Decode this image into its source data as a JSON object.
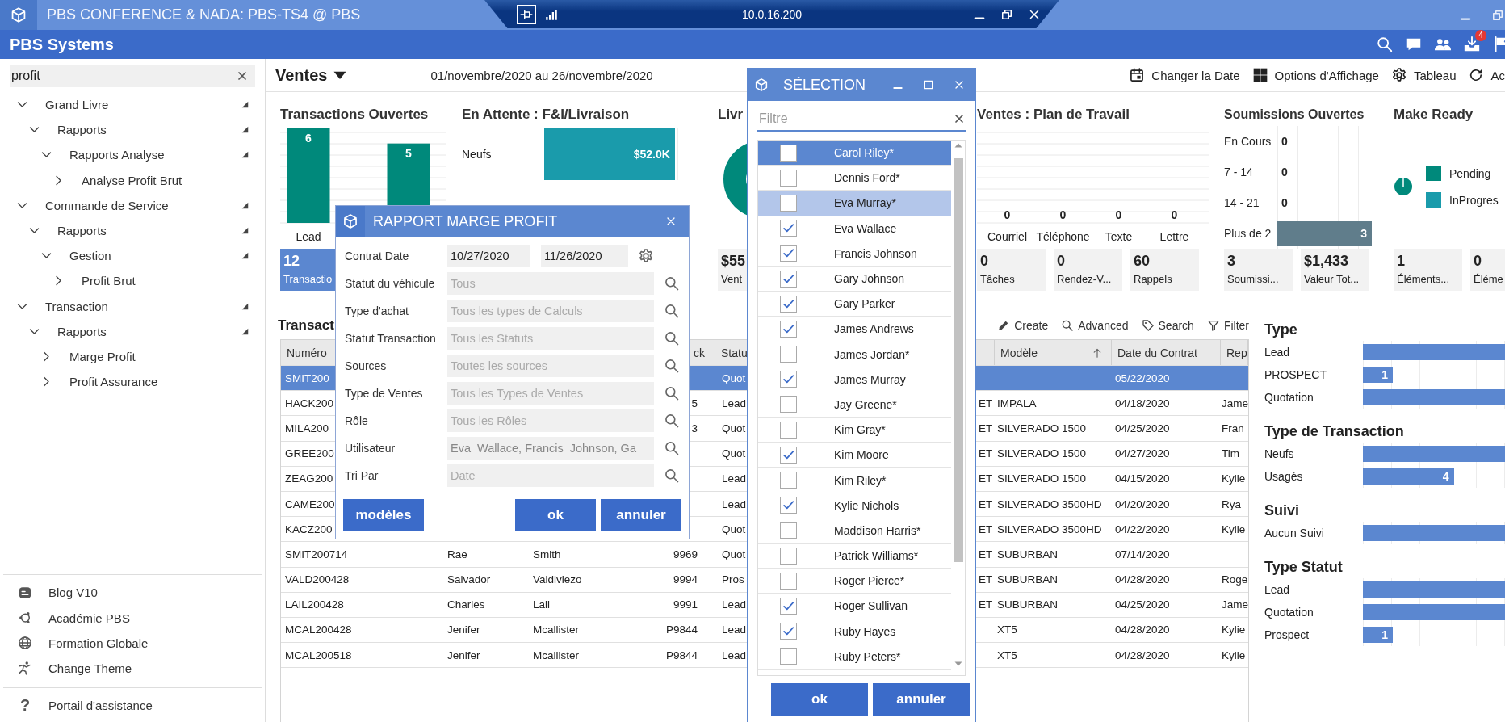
{
  "window": {
    "title": "PBS CONFERENCE & NADA: PBS-TS4 @ PBS"
  },
  "connection_bar": {
    "host": "10.0.16.200"
  },
  "app_header": {
    "title": "PBS Systems",
    "badge": "4"
  },
  "sidebar": {
    "search": {
      "value": "profit"
    },
    "tree": [
      {
        "label": "Grand Livre",
        "expanded": true,
        "children": [
          {
            "label": "Rapports",
            "expanded": true,
            "children": [
              {
                "label": "Rapports Analyse",
                "expanded": true,
                "children": [
                  {
                    "label": "Analyse Profit Brut",
                    "expanded": false
                  }
                ]
              }
            ]
          }
        ]
      },
      {
        "label": "Commande de Service",
        "expanded": true,
        "children": [
          {
            "label": "Rapports",
            "expanded": true,
            "children": [
              {
                "label": "Gestion",
                "expanded": true,
                "children": [
                  {
                    "label": "Profit Brut",
                    "expanded": false
                  }
                ]
              }
            ]
          }
        ]
      },
      {
        "label": "Transaction",
        "expanded": true,
        "children": [
          {
            "label": "Rapports",
            "expanded": true,
            "children": [
              {
                "label": "Marge Profit",
                "expanded": false
              },
              {
                "label": "Profit Assurance",
                "expanded": false
              }
            ]
          }
        ]
      }
    ],
    "links": [
      {
        "kind": "blog",
        "label": "Blog V10"
      },
      {
        "kind": "academy",
        "label": "Académie PBS"
      },
      {
        "kind": "globe",
        "label": "Formation Globale"
      },
      {
        "kind": "theme",
        "label": "Change Theme"
      }
    ],
    "help": {
      "icon": "?",
      "label": "Portail d'assistance"
    }
  },
  "toolbar": {
    "view": "Ventes",
    "period": "01/novembre/2020 au 26/novembre/2020",
    "actions": [
      {
        "kind": "calendar",
        "label": "Changer la Date"
      },
      {
        "kind": "grid",
        "label": "Options d'Affichage"
      },
      {
        "kind": "gear",
        "label": "Tableau"
      },
      {
        "kind": "refresh",
        "label": "Ac"
      }
    ]
  },
  "widgets": [
    {
      "kind": "chart",
      "title": "Transactions Ouvertes",
      "chart_data": {
        "type": "bar",
        "categories": [
          "Lead",
          null
        ],
        "series": [
          {
            "color": "#00897b",
            "values": [
              6,
              5
            ]
          }
        ],
        "data_labels": true
      },
      "stats": [
        {
          "value": "12",
          "label": "Transactio",
          "selected": true
        }
      ]
    },
    {
      "kind": "bar_list",
      "title": "En Attente : F&I/Livraison",
      "rows": [
        {
          "label": "Neufs",
          "level": 0.83,
          "value": "$52.0K"
        }
      ]
    },
    {
      "kind": "donut",
      "title": "Livr",
      "stats": [
        {
          "value": "$55",
          "label": "Vent",
          "selected": false
        }
      ]
    },
    {
      "kind": "counts",
      "title": "Ventes : Plan de Travail",
      "columns": [
        {
          "label": "Courriel",
          "value": "0"
        },
        {
          "label": "Téléphone",
          "value": "0"
        },
        {
          "label": "Texte",
          "value": "0"
        },
        {
          "label": "Lettre",
          "value": "0"
        }
      ],
      "stats": [
        {
          "value": "0",
          "label": "Tâches",
          "selected": false
        },
        {
          "value": "0",
          "label": "Rendez-V...",
          "selected": false
        },
        {
          "value": "60",
          "label": "Rappels",
          "selected": false
        }
      ]
    },
    {
      "kind": "bar_list",
      "title": "Soumissions Ouvertes",
      "rows": [
        {
          "label": "En Cours",
          "level": 0,
          "value": "0"
        },
        {
          "label": "7 - 14",
          "level": 0,
          "value": "0"
        },
        {
          "label": "14 - 21",
          "level": 0,
          "value": "0"
        },
        {
          "label": "Plus de 2",
          "level": 1,
          "value": "3"
        }
      ],
      "stats": [
        {
          "value": "3",
          "label": "Soumissi...",
          "selected": false
        },
        {
          "value": "$1,433",
          "label": "Valeur Tot...",
          "selected": false
        }
      ]
    },
    {
      "kind": "pie",
      "title": "Make Ready",
      "legend": [
        {
          "label": "Pending",
          "color": "#00897b"
        },
        {
          "label": "InProgres",
          "color": "#1a9bab"
        }
      ],
      "stats": [
        {
          "value": "1",
          "label": "Éléments...",
          "selected": false
        },
        {
          "value": "0",
          "label": "Éléme",
          "selected": false
        }
      ]
    }
  ],
  "transactions": {
    "title": "Transact",
    "tools": [
      {
        "kind": "create",
        "label": "Create"
      },
      {
        "kind": "advanced",
        "label": "Advanced"
      },
      {
        "kind": "search",
        "label": "Search"
      },
      {
        "kind": "filter",
        "label": "Filter"
      }
    ],
    "columns": [
      {
        "label": "Numéro",
        "sorted": false
      },
      null,
      null,
      {
        "label": "ck",
        "sorted": false
      },
      {
        "label": "Statu",
        "sorted": false
      },
      null,
      {
        "label": "Modèle",
        "sorted": true
      },
      {
        "label": "Date du Contrat",
        "sorted": false
      },
      {
        "label": "Rep",
        "sorted": false
      }
    ],
    "rows": [
      {
        "selected": true,
        "cells": [
          "SMIT200",
          null,
          null,
          null,
          "Quot",
          null,
          null,
          "05/22/2020",
          null
        ]
      },
      {
        "selected": false,
        "cells": [
          "HACK200",
          null,
          null,
          "5",
          "Lead",
          "ET",
          "IMPALA",
          "04/18/2020",
          "Jame"
        ]
      },
      {
        "selected": false,
        "cells": [
          "MILA200",
          null,
          null,
          "3",
          "Quot",
          "ET",
          "SILVERADO 1500",
          "04/25/2020",
          "Fran"
        ]
      },
      {
        "selected": false,
        "cells": [
          "GREE200",
          null,
          null,
          null,
          "Quot",
          "ET",
          "SILVERADO 1500",
          "04/27/2020",
          "Tim"
        ]
      },
      {
        "selected": false,
        "cells": [
          "ZEAG200",
          null,
          null,
          null,
          "Lead",
          "ET",
          "SILVERADO 1500",
          "04/15/2020",
          "Kylie"
        ]
      },
      {
        "selected": false,
        "cells": [
          "CAME200",
          null,
          null,
          null,
          "Lead",
          "ET",
          "SILVERADO 3500HD",
          "04/20/2020",
          "Rya"
        ]
      },
      {
        "selected": false,
        "cells": [
          "KACZ200",
          null,
          null,
          null,
          "Quot",
          "ET",
          "SILVERADO 3500HD",
          "04/22/2020",
          "Kylie"
        ]
      },
      {
        "selected": false,
        "cells": [
          "SMIT200714",
          "Rae",
          "Smith",
          "9969",
          "Quot",
          "ET",
          "SUBURBAN",
          "07/14/2020",
          null
        ]
      },
      {
        "selected": false,
        "cells": [
          "VALD200428",
          "Salvador",
          "Valdiviezo",
          "9994",
          "Pros",
          "ET",
          "SUBURBAN",
          "04/28/2020",
          "Roge"
        ]
      },
      {
        "selected": false,
        "cells": [
          "LAIL200428",
          "Charles",
          "Lail",
          "9991",
          "Lead",
          "ET",
          "SUBURBAN",
          "04/25/2020",
          "Jame"
        ]
      },
      {
        "selected": false,
        "cells": [
          "MCAL200428",
          "Jenifer",
          "Mcallister",
          "P9844",
          "Lead",
          null,
          "XT5",
          "04/28/2020",
          "Kylie"
        ]
      },
      {
        "selected": false,
        "cells": [
          "MCAL200518",
          "Jenifer",
          "Mcallister",
          "P9844",
          "Lead",
          null,
          "XT5",
          "04/28/2020",
          "Kylie"
        ]
      }
    ]
  },
  "breakdown": [
    {
      "title": "Type",
      "rows": [
        {
          "label": "Lead",
          "level": 1
        },
        {
          "label": "PROSPECT",
          "level": 0.21,
          "value": "1"
        },
        {
          "label": "Quotation",
          "level": 1
        }
      ]
    },
    {
      "title": "Type de Transaction",
      "rows": [
        {
          "label": "Neufs",
          "level": 1
        },
        {
          "label": "Usagés",
          "level": 0.64,
          "value": "4"
        }
      ]
    },
    {
      "title": "Suivi",
      "rows": [
        {
          "label": "Aucun Suivi",
          "level": 1
        }
      ]
    },
    {
      "title": "Type Statut",
      "rows": [
        {
          "label": "Lead",
          "level": 1
        },
        {
          "label": "Quotation",
          "level": 1
        },
        {
          "label": "Prospect",
          "level": 0.21,
          "value": "1"
        }
      ]
    }
  ],
  "report_dialog": {
    "title": "RAPPORT MARGE PROFIT",
    "fields": [
      {
        "kind": "date_range",
        "label": "Contrat Date",
        "values": [
          "10/27/2020",
          "11/26/2020"
        ]
      },
      {
        "kind": "lookup",
        "label": "Statut du véhicule",
        "placeholder": "Tous"
      },
      {
        "kind": "lookup",
        "label": "Type d'achat",
        "placeholder": "Tous les types de Calculs"
      },
      {
        "kind": "lookup",
        "label": "Statut Transaction",
        "placeholder": "Tous les Statuts"
      },
      {
        "kind": "lookup",
        "label": "Sources",
        "placeholder": "Toutes les sources"
      },
      {
        "kind": "lookup",
        "label": "Type de Ventes",
        "placeholder": "Tous les Types de Ventes"
      },
      {
        "kind": "lookup",
        "label": "Rôle",
        "placeholder": "Tous les Rôles"
      },
      {
        "kind": "lookup",
        "label": "Utilisateur",
        "value": "Eva  Wallace, Francis  Johnson, Ga"
      },
      {
        "kind": "lookup",
        "label": "Tri Par",
        "placeholder": "Date"
      }
    ],
    "buttons": [
      {
        "label": "modèles"
      },
      {
        "label": "ok"
      },
      {
        "label": "annuler"
      }
    ]
  },
  "selection_dialog": {
    "title": "SÉLECTION",
    "filter": {
      "placeholder": "Filtre"
    },
    "items": [
      {
        "label": "Carol Riley*",
        "checked": false,
        "selected": true,
        "hovered": false
      },
      {
        "label": "Dennis Ford*",
        "checked": false,
        "selected": false,
        "hovered": false
      },
      {
        "label": "Eva Murray*",
        "checked": false,
        "selected": false,
        "hovered": true
      },
      {
        "label": "Eva Wallace",
        "checked": true,
        "selected": false,
        "hovered": false
      },
      {
        "label": "Francis Johnson",
        "checked": true,
        "selected": false,
        "hovered": false
      },
      {
        "label": "Gary Johnson",
        "checked": true,
        "selected": false,
        "hovered": false
      },
      {
        "label": "Gary Parker",
        "checked": true,
        "selected": false,
        "hovered": false
      },
      {
        "label": "James Andrews",
        "checked": true,
        "selected": false,
        "hovered": false
      },
      {
        "label": "James Jordan*",
        "checked": false,
        "selected": false,
        "hovered": false
      },
      {
        "label": "James Murray",
        "checked": true,
        "selected": false,
        "hovered": false
      },
      {
        "label": "Jay Greene*",
        "checked": false,
        "selected": false,
        "hovered": false
      },
      {
        "label": "Kim Gray*",
        "checked": false,
        "selected": false,
        "hovered": false
      },
      {
        "label": "Kim Moore",
        "checked": true,
        "selected": false,
        "hovered": false
      },
      {
        "label": "Kim Riley*",
        "checked": false,
        "selected": false,
        "hovered": false
      },
      {
        "label": "Kylie Nichols",
        "checked": true,
        "selected": false,
        "hovered": false
      },
      {
        "label": "Maddison Harris*",
        "checked": false,
        "selected": false,
        "hovered": false
      },
      {
        "label": "Patrick Williams*",
        "checked": false,
        "selected": false,
        "hovered": false
      },
      {
        "label": "Roger Pierce*",
        "checked": false,
        "selected": false,
        "hovered": false
      },
      {
        "label": "Roger Sullivan",
        "checked": true,
        "selected": false,
        "hovered": false
      },
      {
        "label": "Ruby Hayes",
        "checked": true,
        "selected": false,
        "hovered": false
      },
      {
        "label": "Ruby Peters*",
        "checked": false,
        "selected": false,
        "hovered": false
      }
    ],
    "buttons": [
      {
        "label": "ok"
      },
      {
        "label": "annuler"
      }
    ]
  }
}
